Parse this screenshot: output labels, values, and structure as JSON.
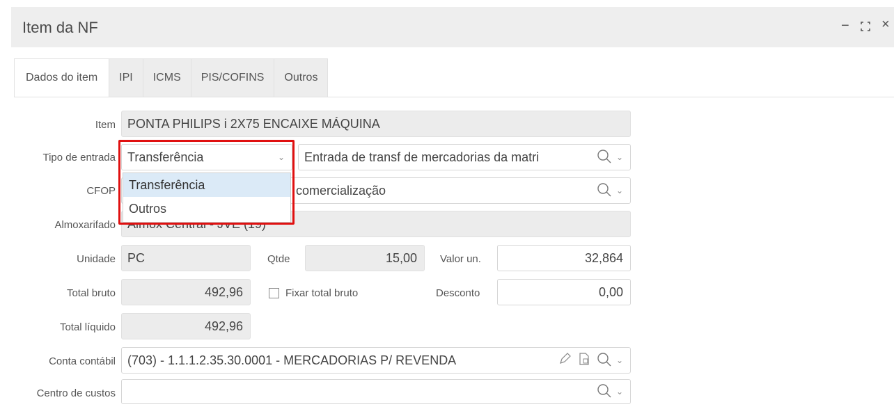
{
  "window": {
    "title": "Item da NF",
    "minimize_glyph": "−",
    "maximize_glyph": "⛶",
    "close_glyph": "×"
  },
  "tabs": [
    {
      "label": "Dados do item",
      "active": true
    },
    {
      "label": "IPI",
      "active": false
    },
    {
      "label": "ICMS",
      "active": false
    },
    {
      "label": "PIS/COFINS",
      "active": false
    },
    {
      "label": "Outros",
      "active": false
    }
  ],
  "form": {
    "item": {
      "label": "Item",
      "value": "PONTA PHILIPS i 2X75 ENCAIXE MÁQUINA"
    },
    "tipo_entrada": {
      "label": "Tipo de entrada",
      "value": "Transferência",
      "options": [
        "Transferência",
        "Outros"
      ],
      "lookup_value": "Entrada de transf de mercadorias da matri"
    },
    "cfop": {
      "label": "CFOP",
      "value": "comercialização"
    },
    "almoxarifado": {
      "label": "Almoxarifado",
      "value": "Almox Central - JVE (19)"
    },
    "unidade": {
      "label": "Unidade",
      "value": "PC"
    },
    "qtde": {
      "label": "Qtde",
      "value": "15,00"
    },
    "valor_un": {
      "label": "Valor un.",
      "value": "32,864"
    },
    "total_bruto": {
      "label": "Total bruto",
      "value": "492,96"
    },
    "fixar_total_bruto": {
      "label": "Fixar total bruto",
      "checked": false
    },
    "desconto": {
      "label": "Desconto",
      "value": "0,00"
    },
    "total_liquido": {
      "label": "Total líquido",
      "value": "492,96"
    },
    "conta_contabil": {
      "label": "Conta contábil",
      "value": "(703) - 1.1.1.2.35.30.0001 - MERCADORIAS P/ REVENDA"
    },
    "centro_custos": {
      "label": "Centro de custos",
      "value": ""
    }
  },
  "colors": {
    "highlight": "#e01010",
    "selected_option": "#dbeaf7",
    "readonly_bg": "#ececec"
  }
}
